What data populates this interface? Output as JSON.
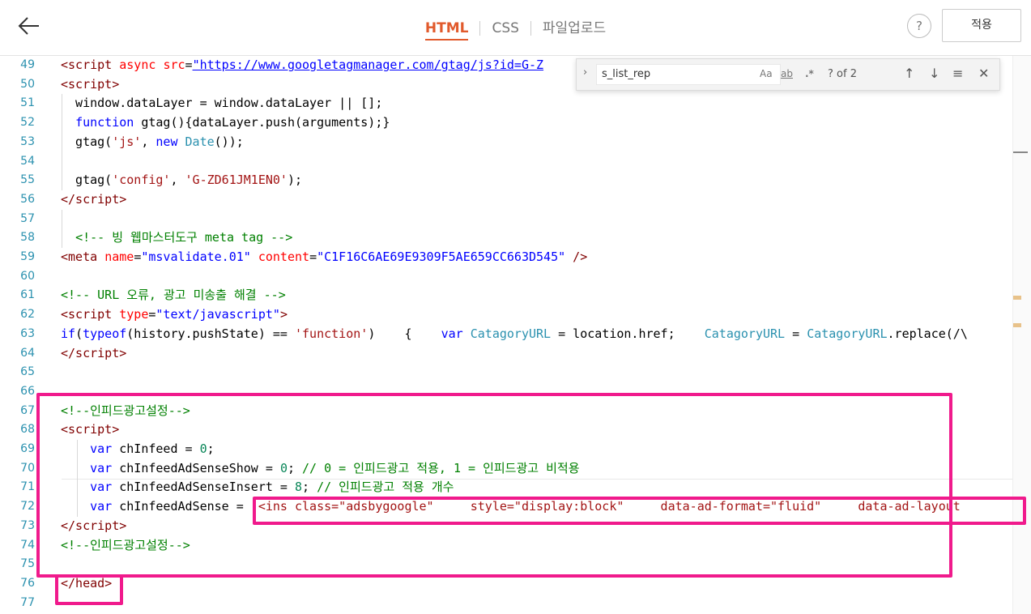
{
  "header": {
    "tabs": [
      "HTML",
      "CSS",
      "파일업로드"
    ],
    "help": "?",
    "apply_label": "적용"
  },
  "find": {
    "query": "s_list_rep",
    "match_case": "Aa",
    "whole_word": "ab",
    "regex": ".*",
    "count": "? of 2"
  },
  "lines": [
    {
      "n": "49",
      "html": "<span class=\"c-tag\">&lt;script</span> <span class=\"c-attr\">async</span> <span class=\"c-attr\">src</span>=<span class=\"c-str\"><u>\"https://www.googletagmanager.com/gtag/js?id=G-Z</u></span>"
    },
    {
      "n": "50",
      "html": "<span class=\"c-tag\">&lt;script&gt;</span>"
    },
    {
      "n": "51",
      "html": "  window.dataLayer = window.dataLayer || [];"
    },
    {
      "n": "52",
      "html": "  <span class=\"c-kw\">function</span> gtag(){dataLayer.push(arguments);}"
    },
    {
      "n": "53",
      "html": "  gtag(<span class=\"c-sq\">'js'</span>, <span class=\"c-kw\">new</span> <span class=\"c-type\">Date</span>());"
    },
    {
      "n": "54",
      "html": ""
    },
    {
      "n": "55",
      "html": "  gtag(<span class=\"c-sq\">'config'</span>, <span class=\"c-sq\">'G-ZD61JM1EN0'</span>);"
    },
    {
      "n": "56",
      "html": "<span class=\"c-tag\">&lt;/script&gt;</span>"
    },
    {
      "n": "57",
      "html": ""
    },
    {
      "n": "58",
      "html": "  <span class=\"c-com\">&lt;!-- 빙 웹마스터도구 meta tag --&gt;</span>"
    },
    {
      "n": "59",
      "html": "<span class=\"c-tag\">&lt;meta</span> <span class=\"c-attr\">name</span>=<span class=\"c-str\">\"msvalidate.01\"</span> <span class=\"c-attr\">content</span>=<span class=\"c-str\">\"C1F16C6AE69E9309F5AE659CC663D545\"</span> <span class=\"c-tag\">/&gt;</span>"
    },
    {
      "n": "60",
      "html": ""
    },
    {
      "n": "61",
      "html": "<span class=\"c-com\">&lt;!-- URL 오류, 광고 미송출 해결 --&gt;</span>"
    },
    {
      "n": "62",
      "html": "<span class=\"c-tag\">&lt;script</span> <span class=\"c-attr\">type</span>=<span class=\"c-str\">\"text/javascript\"</span><span class=\"c-tag\">&gt;</span>"
    },
    {
      "n": "63",
      "html": "<span class=\"c-kw\">if</span>(<span class=\"c-kw\">typeof</span>(history.pushState) == <span class=\"c-sq\">'function'</span>)    {    <span class=\"c-kw\">var</span> <span class=\"c-type\">CatagoryURL</span> = location.href;    <span class=\"c-type\">CatagoryURL</span> = <span class=\"c-type\">CatagoryURL</span>.replace(/\\"
    },
    {
      "n": "64",
      "html": "<span class=\"c-tag\">&lt;/script&gt;</span>"
    },
    {
      "n": "65",
      "html": ""
    },
    {
      "n": "66",
      "html": ""
    },
    {
      "n": "67",
      "html": "<span class=\"c-com\">&lt;!--인피드광고설정--&gt;</span>"
    },
    {
      "n": "68",
      "html": "<span class=\"c-tag\">&lt;script&gt;</span>"
    },
    {
      "n": "69",
      "html": "    <span class=\"c-kw\">var</span> chInfeed = <span class=\"c-num\">0</span>;"
    },
    {
      "n": "70",
      "html": "    <span class=\"c-kw\">var</span> chInfeedAdSenseShow = <span class=\"c-num\">0</span>; <span class=\"c-com\">// 0 = 인피드광고 적용, 1 = 인피드광고 비적용</span>"
    },
    {
      "n": "71",
      "html": "    <span class=\"c-kw\">var</span> chInfeedAdSenseInsert = <span class=\"c-num\">8</span>; <span class=\"c-com\">// 인피드광고 적용 개수</span>"
    },
    {
      "n": "72",
      "html": "    <span class=\"c-kw\">var</span> chInfeedAdSense = <span class=\"c-sq\">'&lt;ins class=\"adsbygoogle\"     style=\"display:block\"     data-ad-format=\"fluid\"     data-ad-layout</span>"
    },
    {
      "n": "73",
      "html": "<span class=\"c-tag\">&lt;/script&gt;</span>"
    },
    {
      "n": "74",
      "html": "<span class=\"c-com\">&lt;!--인피드광고설정--&gt;</span>"
    },
    {
      "n": "75",
      "html": ""
    },
    {
      "n": "76",
      "html": "<span class=\"c-tag\">&lt;/head&gt;</span>"
    },
    {
      "n": "77",
      "html": ""
    }
  ]
}
